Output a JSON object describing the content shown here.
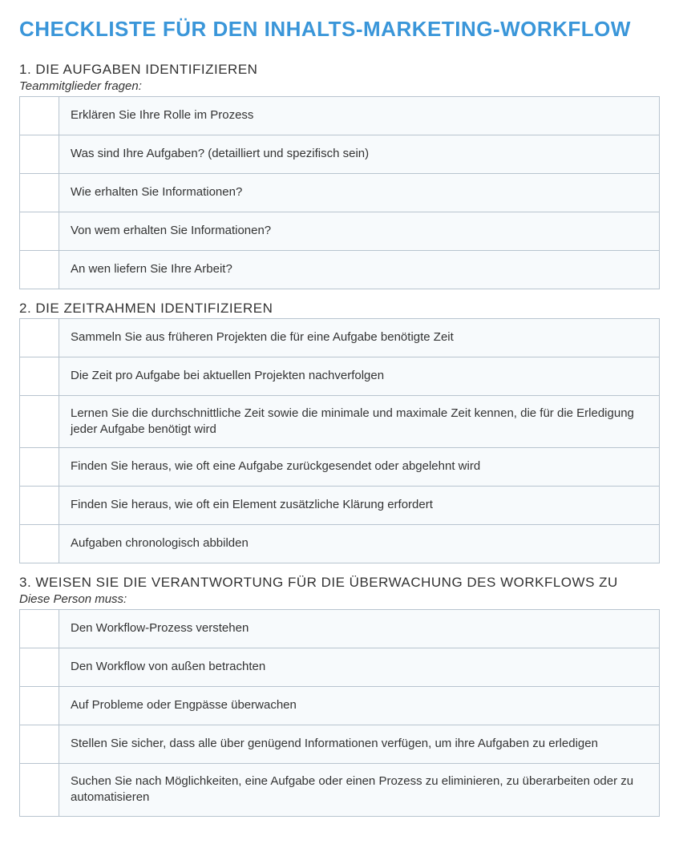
{
  "title": "CHECKLISTE FÜR DEN INHALTS-MARKETING-WORKFLOW",
  "sections": [
    {
      "heading": "1. DIE AUFGABEN IDENTIFIZIEREN",
      "sub": "Teammitglieder fragen:",
      "items": [
        "Erklären Sie Ihre Rolle im Prozess",
        "Was sind Ihre Aufgaben? (detailliert und spezifisch sein)",
        "Wie erhalten Sie Informationen?",
        "Von wem erhalten Sie Informationen?",
        "An wen liefern Sie Ihre Arbeit?"
      ]
    },
    {
      "heading": "2. DIE ZEITRAHMEN IDENTIFIZIEREN",
      "sub": "",
      "items": [
        "Sammeln Sie aus früheren Projekten die für eine Aufgabe benötigte Zeit",
        "Die Zeit pro Aufgabe bei aktuellen Projekten nachverfolgen",
        "Lernen Sie die durchschnittliche Zeit sowie die minimale und maximale Zeit kennen, die für die Erledigung jeder Aufgabe benötigt wird",
        "Finden Sie heraus, wie oft eine Aufgabe zurückgesendet oder abgelehnt wird",
        "Finden Sie heraus, wie oft ein Element zusätzliche Klärung erfordert",
        "Aufgaben chronologisch abbilden"
      ]
    },
    {
      "heading": "3. WEISEN SIE DIE VERANTWORTUNG FÜR DIE ÜBERWACHUNG DES WORKFLOWS ZU",
      "sub": "Diese Person muss:",
      "items": [
        "Den Workflow-Prozess verstehen",
        "Den Workflow von außen betrachten",
        "Auf Probleme oder Engpässe überwachen",
        "Stellen Sie sicher, dass alle über genügend Informationen verfügen, um ihre Aufgaben zu erledigen",
        "Suchen Sie nach Möglichkeiten, eine Aufgabe oder einen Prozess zu eliminieren, zu überarbeiten oder zu automatisieren"
      ]
    }
  ]
}
